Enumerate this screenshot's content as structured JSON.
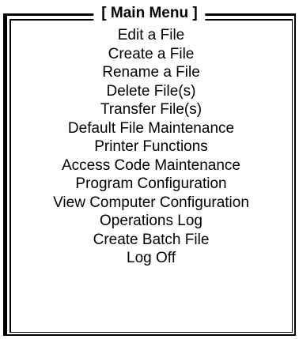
{
  "menu": {
    "title": "[ Main Menu ]",
    "items": [
      {
        "label": "Edit a File"
      },
      {
        "label": "Create a File"
      },
      {
        "label": "Rename a File"
      },
      {
        "label": "Delete File(s)"
      },
      {
        "label": "Transfer File(s)"
      },
      {
        "label": "Default File Maintenance"
      },
      {
        "label": "Printer Functions"
      },
      {
        "label": "Access Code Maintenance"
      },
      {
        "label": "Program Configuration"
      },
      {
        "label": "View Computer Configuration"
      },
      {
        "label": "Operations Log"
      },
      {
        "label": "Create Batch File"
      },
      {
        "label": "Log Off"
      }
    ]
  }
}
